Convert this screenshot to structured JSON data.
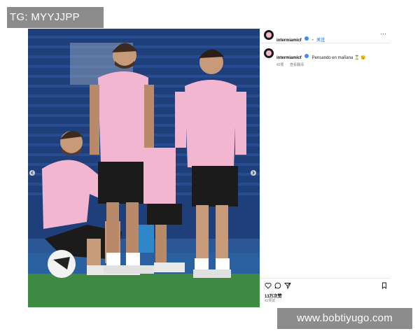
{
  "watermark_top": "TG: MYYJJPP",
  "watermark_bottom": "www.bobtiyugo.com",
  "post": {
    "header_username": "intermiamicf",
    "follow_label": "关注",
    "caption_username": "intermiamicf",
    "caption_text": "Pensando en mañana ⏳ 😉",
    "caption_time": "42周",
    "translation_label": "查看翻译",
    "likes_label": "13万次赞",
    "time_label": "42周前"
  },
  "icons": {
    "more": "more-options-icon",
    "like": "heart-icon",
    "comment": "comment-icon",
    "share": "share-icon",
    "save": "bookmark-icon",
    "verified": "verified-badge-icon"
  },
  "colors": {
    "jersey_pink": "#f2b6d0",
    "shorts_black": "#1b1b1b",
    "stadium_blue": "#1e3e7a",
    "pitch_green": "#3e8a42",
    "link_blue": "#3a8bf3",
    "watermark_gray": "#8c8c8c"
  }
}
